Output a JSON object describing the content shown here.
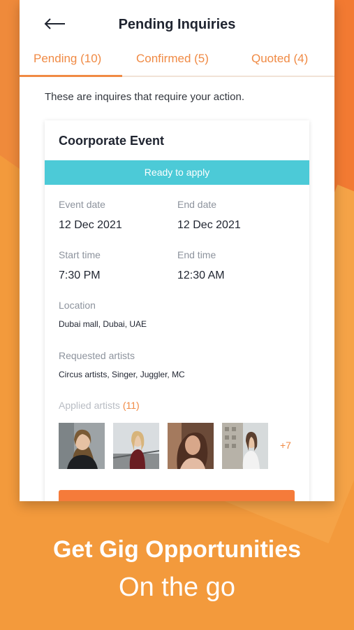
{
  "header": {
    "title": "Pending Inquiries",
    "back_icon": "back-arrow-icon"
  },
  "tabs": [
    {
      "label": "Pending (10)",
      "active": true
    },
    {
      "label": "Confirmed (5)",
      "active": false
    },
    {
      "label": "Quoted (4)",
      "active": false
    }
  ],
  "intro_text": "These are inquires that require your action.",
  "card": {
    "title": "Coorporate Event",
    "status": "Ready to apply",
    "event_date_label": "Event date",
    "event_date": "12 Dec 2021",
    "end_date_label": "End date",
    "end_date": "12 Dec 2021",
    "start_time_label": "Start time",
    "start_time": "7:30 PM",
    "end_time_label": "End time",
    "end_time": "12:30 AM",
    "location_label": "Location",
    "location": "Dubai mall, Dubai, UAE",
    "requested_label": "Requested artists",
    "requested": "Circus artists, Singer, Juggler, MC",
    "applied_label": "Applied artists",
    "applied_count": "(11)",
    "more_count": "+7"
  },
  "promo": {
    "headline": "Get Gig Opportunities",
    "subheadline": "On the go"
  },
  "colors": {
    "accent": "#f08a44",
    "status_bar": "#4ccad7",
    "background": "#f39a3c"
  }
}
